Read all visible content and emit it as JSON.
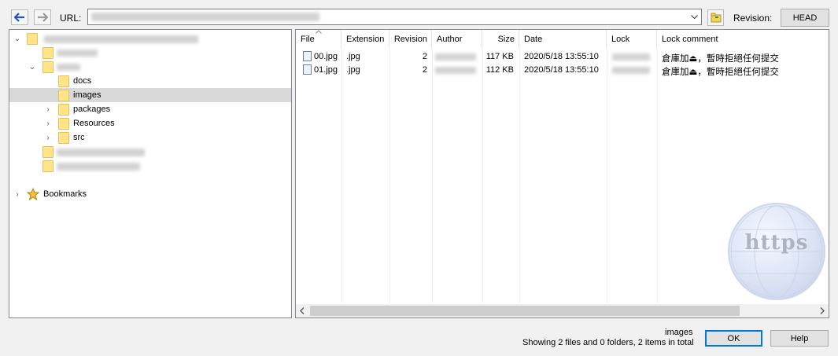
{
  "toolbar": {
    "back_icon": "back-arrow-icon",
    "forward_icon": "forward-arrow-icon",
    "url_label": "URL:",
    "revision_icon": "folder-revision-icon",
    "revision_label": "Revision:",
    "head_button": "HEAD"
  },
  "tree": {
    "items": [
      {
        "label": "docs"
      },
      {
        "label": "images"
      },
      {
        "label": "packages"
      },
      {
        "label": "Resources"
      },
      {
        "label": "src"
      }
    ],
    "bookmarks": "Bookmarks"
  },
  "list": {
    "columns": [
      "File",
      "Extension",
      "Revision",
      "Author",
      "Size",
      "Date",
      "Lock",
      "Lock comment"
    ],
    "rows": [
      {
        "file": "00.jpg",
        "ext": ".jpg",
        "rev": "2",
        "size": "117 KB",
        "date": "2020/5/18 13:55:10",
        "comment": "倉庫加⏏，暫時拒絕任何提交"
      },
      {
        "file": "01.jpg",
        "ext": ".jpg",
        "rev": "2",
        "size": "112 KB",
        "date": "2020/5/18 13:55:10",
        "comment": "倉庫加⏏，暫時拒絕任何提交"
      }
    ]
  },
  "watermark": {
    "text": "https"
  },
  "status": {
    "folder": "images",
    "summary": "Showing 2 files and 0 folders, 2 items in total"
  },
  "buttons": {
    "ok": "OK",
    "help": "Help"
  },
  "colors": {
    "selection": "#d9d9d9",
    "accent": "#0078d7",
    "folder": "#ffe48a"
  }
}
